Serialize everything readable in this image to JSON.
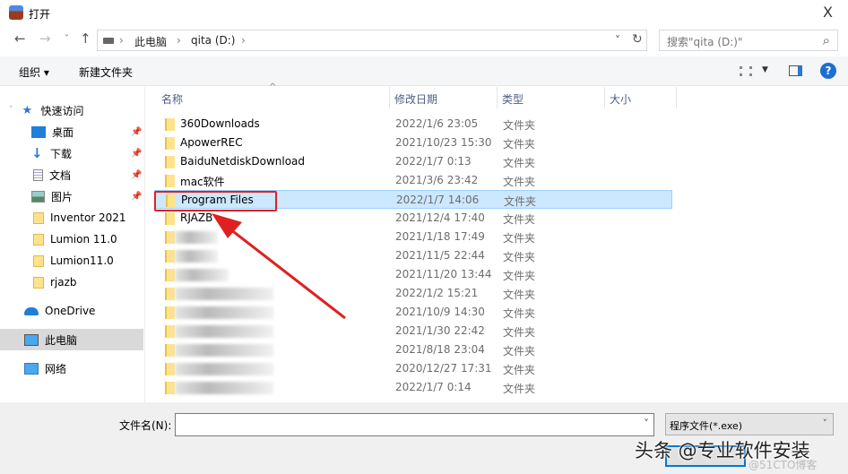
{
  "window": {
    "title": "打开",
    "close": "X"
  },
  "nav": {
    "back": "←",
    "forward": "→",
    "recent": "˅",
    "up": "↑"
  },
  "address": {
    "crumbs": [
      "此电脑",
      "qita (D:)"
    ],
    "sep": "›",
    "dropdown": "˅",
    "refresh": "↻"
  },
  "search": {
    "placeholder": "搜索\"qita (D:)\"",
    "icon": "⌕"
  },
  "toolbar": {
    "organize": "组织 ▾",
    "new_folder": "新建文件夹",
    "help": "?"
  },
  "sidebar": {
    "quick_access": "快速访问",
    "items": [
      {
        "label": "桌面",
        "icon": "desktop-icon",
        "pinned": true
      },
      {
        "label": "下载",
        "icon": "download-icon",
        "pinned": true
      },
      {
        "label": "文档",
        "icon": "document-icon",
        "pinned": true
      },
      {
        "label": "图片",
        "icon": "picture-icon",
        "pinned": true
      },
      {
        "label": "Inventor 2021",
        "icon": "folder-icon"
      },
      {
        "label": "Lumion 11.0",
        "icon": "folder-icon"
      },
      {
        "label": "Lumion11.0",
        "icon": "folder-icon"
      },
      {
        "label": "rjazb",
        "icon": "folder-icon"
      }
    ],
    "onedrive": "OneDrive",
    "this_pc": "此电脑",
    "network": "网络"
  },
  "columns": {
    "name": "名称",
    "date": "修改日期",
    "type": "类型",
    "size": "大小"
  },
  "files": [
    {
      "name": "360Downloads",
      "date": "2022/1/6 23:05",
      "type": "文件夹"
    },
    {
      "name": "ApowerREC",
      "date": "2021/10/23 15:30",
      "type": "文件夹"
    },
    {
      "name": "BaiduNetdiskDownload",
      "date": "2022/1/7 0:13",
      "type": "文件夹"
    },
    {
      "name": "mac软件",
      "date": "2021/3/6 23:42",
      "type": "文件夹"
    },
    {
      "name": "Program Files",
      "date": "2022/1/7 14:06",
      "type": "文件夹",
      "selected": true
    },
    {
      "name": "RJAZB",
      "date": "2021/12/4 17:40",
      "type": "文件夹"
    },
    {
      "name": "",
      "date": "2021/1/18 17:49",
      "type": "文件夹"
    },
    {
      "name": "",
      "date": "2021/11/5 22:44",
      "type": "文件夹"
    },
    {
      "name": "",
      "date": "2021/11/20 13:44",
      "type": "文件夹"
    },
    {
      "name": "",
      "date": "2022/1/2 15:21",
      "type": "文件夹"
    },
    {
      "name": "",
      "date": "2021/10/9 14:30",
      "type": "文件夹"
    },
    {
      "name": "",
      "date": "2021/1/30 22:42",
      "type": "文件夹"
    },
    {
      "name": "",
      "date": "2021/8/18 23:04",
      "type": "文件夹"
    },
    {
      "name": "",
      "date": "2020/12/27 17:31",
      "type": "文件夹"
    },
    {
      "name": "",
      "date": "2022/1/7 0:14",
      "type": "文件夹"
    }
  ],
  "footer": {
    "filename_label": "文件名(N):",
    "filename_value": "",
    "filetype": "程序文件(*.exe)"
  },
  "watermark": {
    "main": "头条 @专业软件安装",
    "sub": "@51CTO博客"
  },
  "colors": {
    "selection": "#cce8ff",
    "highlight": "#e02020",
    "accent": "#0078d7"
  }
}
